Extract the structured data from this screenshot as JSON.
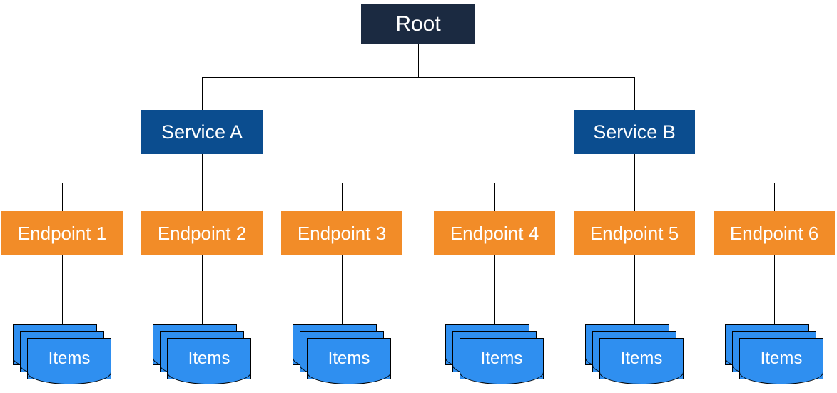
{
  "root": {
    "label": "Root"
  },
  "services": [
    {
      "label": "Service A"
    },
    {
      "label": "Service B"
    }
  ],
  "endpoints": [
    {
      "label": "Endpoint 1"
    },
    {
      "label": "Endpoint 2"
    },
    {
      "label": "Endpoint 3"
    },
    {
      "label": "Endpoint 4"
    },
    {
      "label": "Endpoint 5"
    },
    {
      "label": "Endpoint 6"
    }
  ],
  "items_label": "Items",
  "colors": {
    "root_bg": "#1b2a41",
    "service_bg": "#0b4d8f",
    "endpoint_bg": "#f28c28",
    "items_bg": "#2f8ff0",
    "text": "#ffffff",
    "connector": "#000000"
  }
}
